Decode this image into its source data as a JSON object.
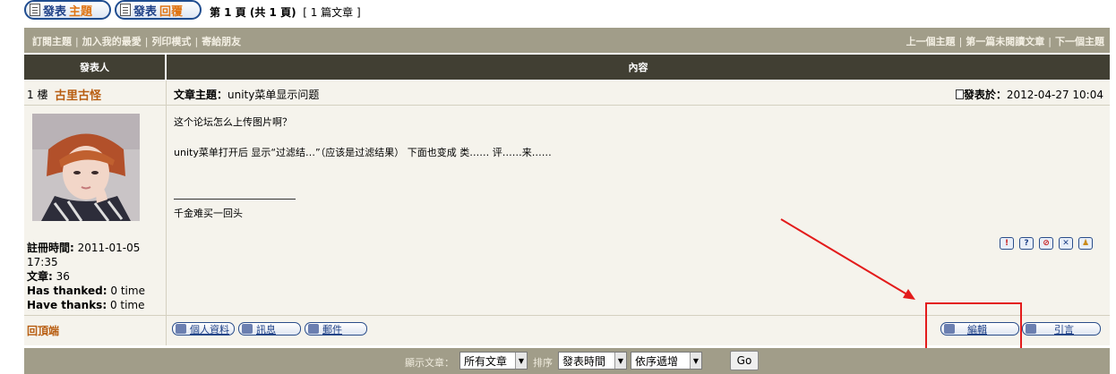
{
  "top_bar": {
    "new_topic_prefix": "發表",
    "new_topic_highlight": "主題",
    "reply_prefix": "發表",
    "reply_highlight": "回覆",
    "page_main": "第 1 頁 (共 1 頁)",
    "page_count": "[ 1 篇文章 ]"
  },
  "nav": {
    "left": [
      "訂閱主題",
      "加入我的最愛",
      "列印模式",
      "寄給朋友"
    ],
    "right": [
      "上一個主題",
      "第一篇未閱讀文章",
      "下一個主題"
    ],
    "separator": "|"
  },
  "table_header": {
    "author": "發表人",
    "content": "內容"
  },
  "post": {
    "floor": "1 樓",
    "author": "古里古怪",
    "subject_label": "文章主題：",
    "subject": "unity菜单显示问题",
    "posted_label": "發表於：",
    "posted_at": "2012-04-27 10:04",
    "body_lines": [
      "这个论坛怎么上传图片啊？",
      "unity菜单打开后 显示“过滤结…”（应该是过滤结果） 下面也变成 类…… 评……来……"
    ],
    "signature": "千金难买一回头",
    "signature_rule": "_________________",
    "meta": {
      "joined_label": "註冊時間:",
      "joined_value_1": " 2011-01-05",
      "joined_value_2": "17:35",
      "posts_label": "文章:",
      "posts_value": " 36",
      "thanked_label": "Has thanked:",
      "thanked_value": " 0 time",
      "thanks_label": "Have thanks:",
      "thanks_value": " 0 time"
    },
    "actions": {
      "back_to_top": "回頂端",
      "profile": "個人資料",
      "pm": "訊息",
      "email": "郵件",
      "edit": "編輯",
      "quote": "引言"
    },
    "mini_icons": [
      "report-icon",
      "info-icon",
      "warn-icon",
      "delete-icon",
      "thumb-icon"
    ]
  },
  "footer": {
    "display_label": "顯示文章：",
    "display_value": "所有文章",
    "sort_label": "排序",
    "sort_value": "發表時間",
    "order_value": "依序遞增",
    "go_label": "Go"
  },
  "colors": {
    "nav_bg": "#a19d89",
    "header_bg": "#413f33",
    "row_bg": "#f5f3ec",
    "author_color": "#b85d10",
    "annotation_red": "#e31b1b"
  }
}
